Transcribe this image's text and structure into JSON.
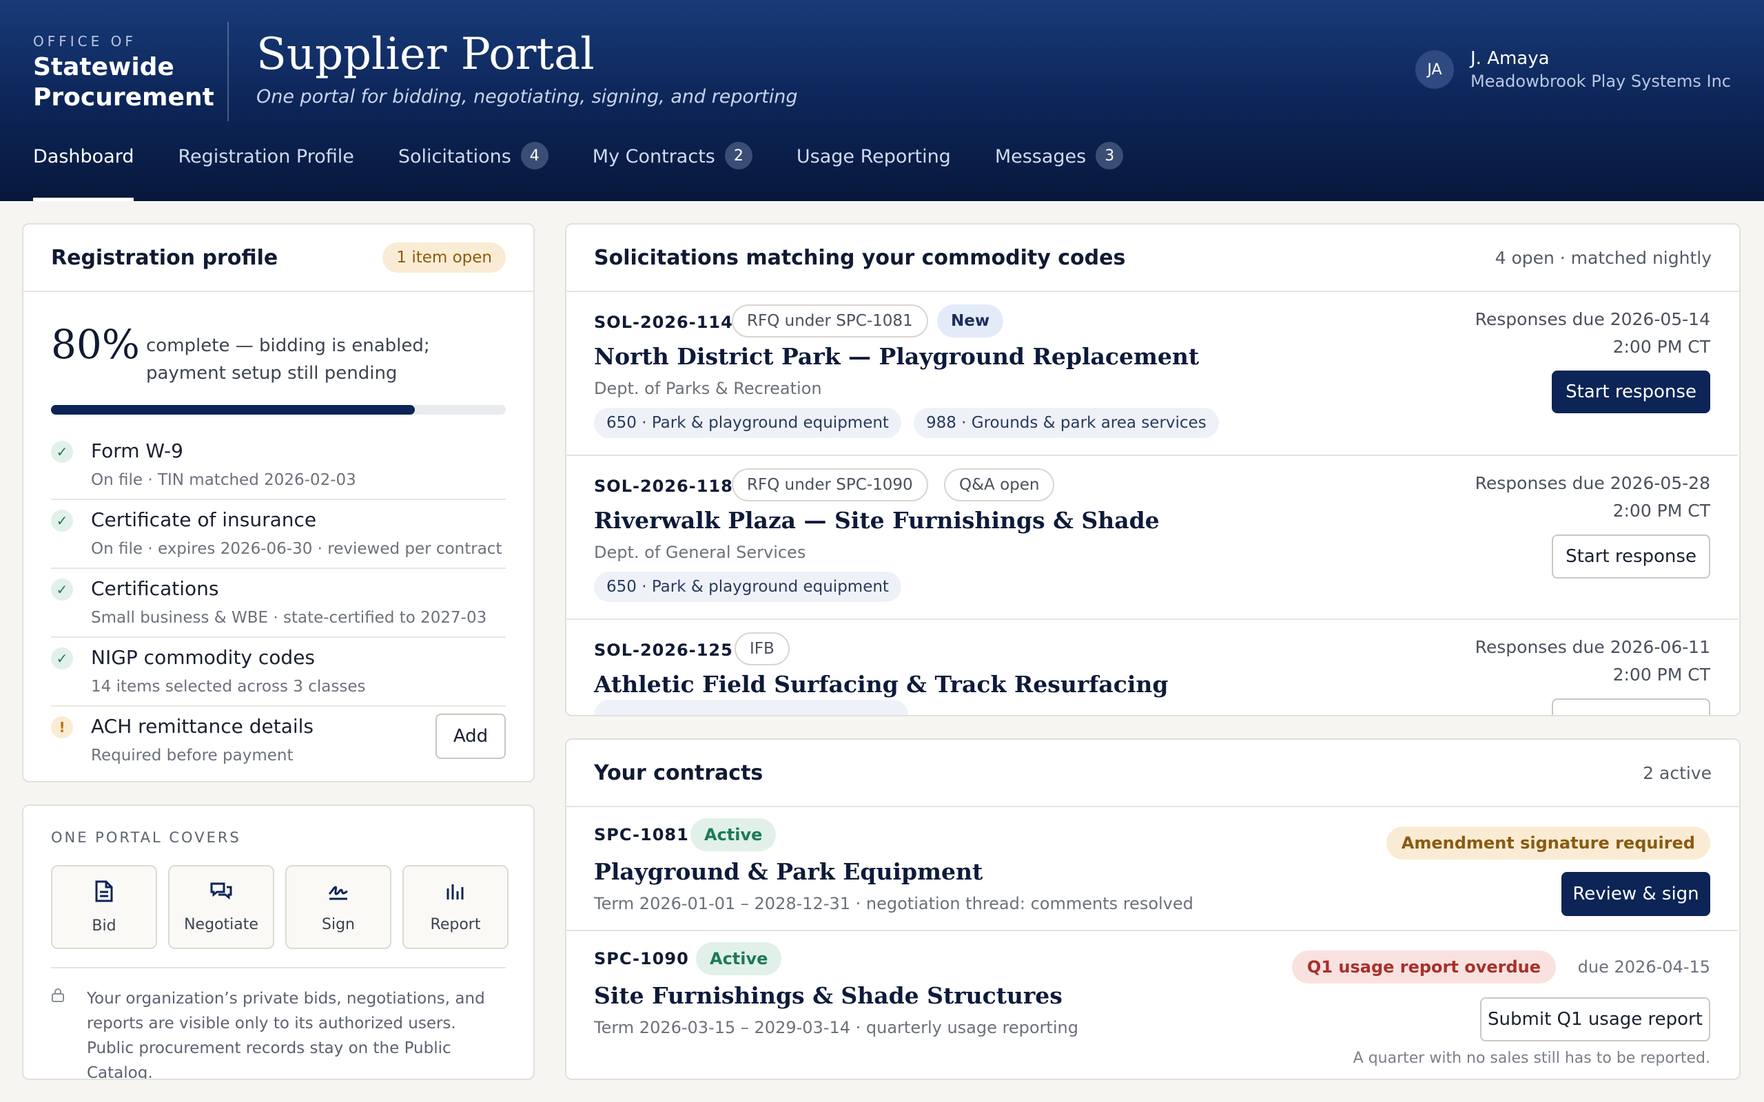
{
  "header": {
    "brand_small": "OFFICE OF",
    "brand_line1": "Statewide",
    "brand_line2": "Procurement",
    "title": "Supplier Portal",
    "subtitle": "One portal for bidding, negotiating, signing, and reporting",
    "user_initials": "JA",
    "user_name": "J. Amaya",
    "user_org": "Meadowbrook Play Systems Inc"
  },
  "nav": {
    "dashboard": "Dashboard",
    "registration": "Registration Profile",
    "solicitations": "Solicitations",
    "solicitations_count": "4",
    "contracts": "My Contracts",
    "contracts_count": "2",
    "usage": "Usage Reporting",
    "messages": "Messages",
    "messages_count": "3"
  },
  "registration": {
    "heading": "Registration profile",
    "badge": "1 item open",
    "percent": "80%",
    "progress": 0.8,
    "percent_text": "complete — bidding is enabled; payment setup still pending",
    "items": [
      {
        "title": "Form W-9",
        "sub": "On file · TIN matched 2026-02-03",
        "icon": "✓"
      },
      {
        "title": "Certificate of insurance",
        "sub": "On file · expires 2026-06-30 · reviewed per contract",
        "icon": "✓"
      },
      {
        "title": "Certifications",
        "sub": "Small business & WBE · state-certified to 2027-03",
        "icon": "✓"
      },
      {
        "title": "NIGP commodity codes",
        "sub": "14 items selected across 3 classes",
        "icon": "✓"
      },
      {
        "title": "ACH remittance details",
        "sub": "Required before payment",
        "icon": "!",
        "action": "Add"
      }
    ]
  },
  "covers": {
    "label": "ONE PORTAL COVERS",
    "tiles": [
      "Bid",
      "Negotiate",
      "Sign",
      "Report"
    ],
    "privacy": "Your organization’s private bids, negotiations, and reports are visible only to its authorized users. Public procurement records stay on the Public Catalog."
  },
  "solicitations": {
    "heading": "Solicitations matching your commodity codes",
    "meta": "4 open · matched nightly",
    "rows": [
      {
        "id": "SOL-2026-114",
        "type": "RFQ under SPC-1081",
        "flag": "New",
        "title": "North District Park — Playground Replacement",
        "dept": "Dept. of Parks & Recreation",
        "chips": [
          "650 · Park & playground equipment",
          "988 · Grounds & park area services"
        ],
        "due": "Responses due 2026-05-14",
        "time": "2:00 PM CT",
        "action": "Start response"
      },
      {
        "id": "SOL-2026-118",
        "type": "RFQ under SPC-1090",
        "flag": "Q&A open",
        "title": "Riverwalk Plaza — Site Furnishings & Shade",
        "dept": "Dept. of General Services",
        "chips": [
          "650 · Park & playground equipment"
        ],
        "due": "Responses due 2026-05-28",
        "time": "2:00 PM CT",
        "action": "Start response"
      },
      {
        "id": "SOL-2026-125",
        "type": "IFB",
        "title": "Athletic Field Surfacing & Track Resurfacing",
        "due": "Responses due 2026-06-11",
        "time": "2:00 PM CT"
      }
    ]
  },
  "contracts": {
    "heading": "Your contracts",
    "meta": "2 active",
    "rows": [
      {
        "id": "SPC-1081",
        "status": "Active",
        "title": "Playground & Park Equipment",
        "term": "Term 2026-01-01 – 2028-12-31  ·  negotiation thread: comments resolved",
        "alert": "Amendment signature required",
        "action": "Review & sign"
      },
      {
        "id": "SPC-1090",
        "status": "Active",
        "title": "Site Furnishings & Shade Structures",
        "term": "Term 2026-03-15 – 2029-03-14  ·  quarterly usage reporting",
        "alert": "Q1 usage report overdue",
        "due": "due 2026-04-15",
        "action": "Submit Q1 usage report",
        "note": "A quarter with no sales still has to be reported."
      }
    ]
  }
}
